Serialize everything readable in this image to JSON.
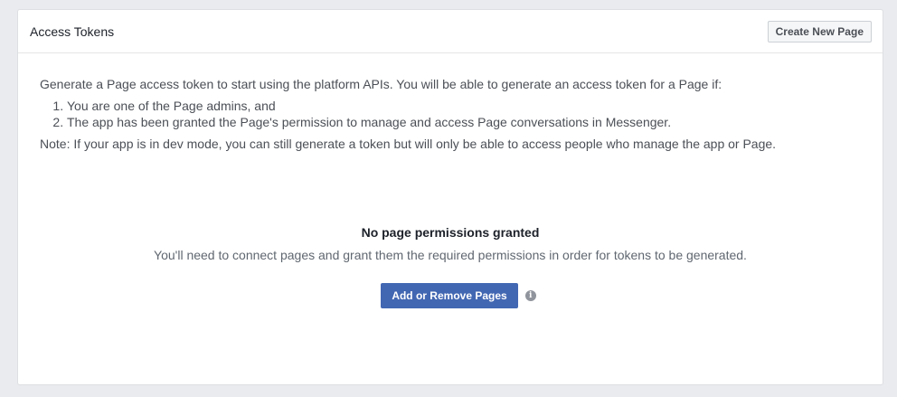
{
  "panel": {
    "title": "Access Tokens",
    "create_button": "Create New Page"
  },
  "content": {
    "intro": "Generate a Page access token to start using the platform APIs. You will be able to generate an access token for a Page if:",
    "conditions": [
      "You are one of the Page admins, and",
      "The app has been granted the Page's permission to manage and access Page conversations in Messenger."
    ],
    "note": "Note: If your app is in dev mode, you can still generate a token but will only be able to access people who manage the app or Page."
  },
  "empty_state": {
    "title": "No page permissions granted",
    "description": "You'll need to connect pages and grant them the required permissions in order for tokens to be generated.",
    "action_button": "Add or Remove Pages",
    "info_icon": "info-icon",
    "info_glyph": "i"
  },
  "colors": {
    "primary": "#4267b2",
    "background": "#e9ebee"
  }
}
